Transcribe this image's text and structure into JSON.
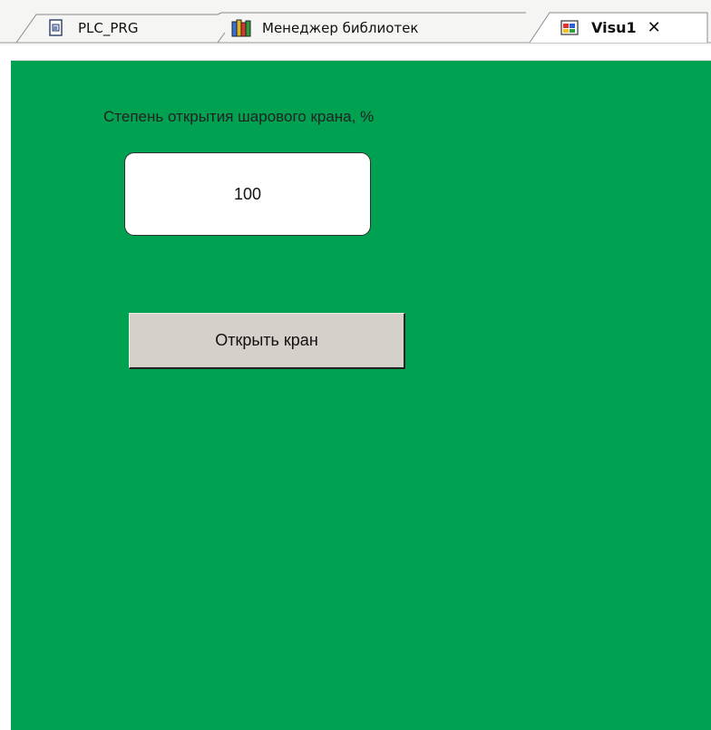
{
  "tabs": [
    {
      "label": "PLC_PRG",
      "icon": "program-document-icon",
      "active": false
    },
    {
      "label": "Менеджер библиотек",
      "icon": "library-books-icon",
      "active": false
    },
    {
      "label": "Visu1",
      "icon": "visualization-icon",
      "active": true
    }
  ],
  "tab_close_label": "✕",
  "visu": {
    "caption": "Степень открытия шарового крана, %",
    "value": "100",
    "button_label": "Открыть кран",
    "background_color": "#00a150"
  }
}
